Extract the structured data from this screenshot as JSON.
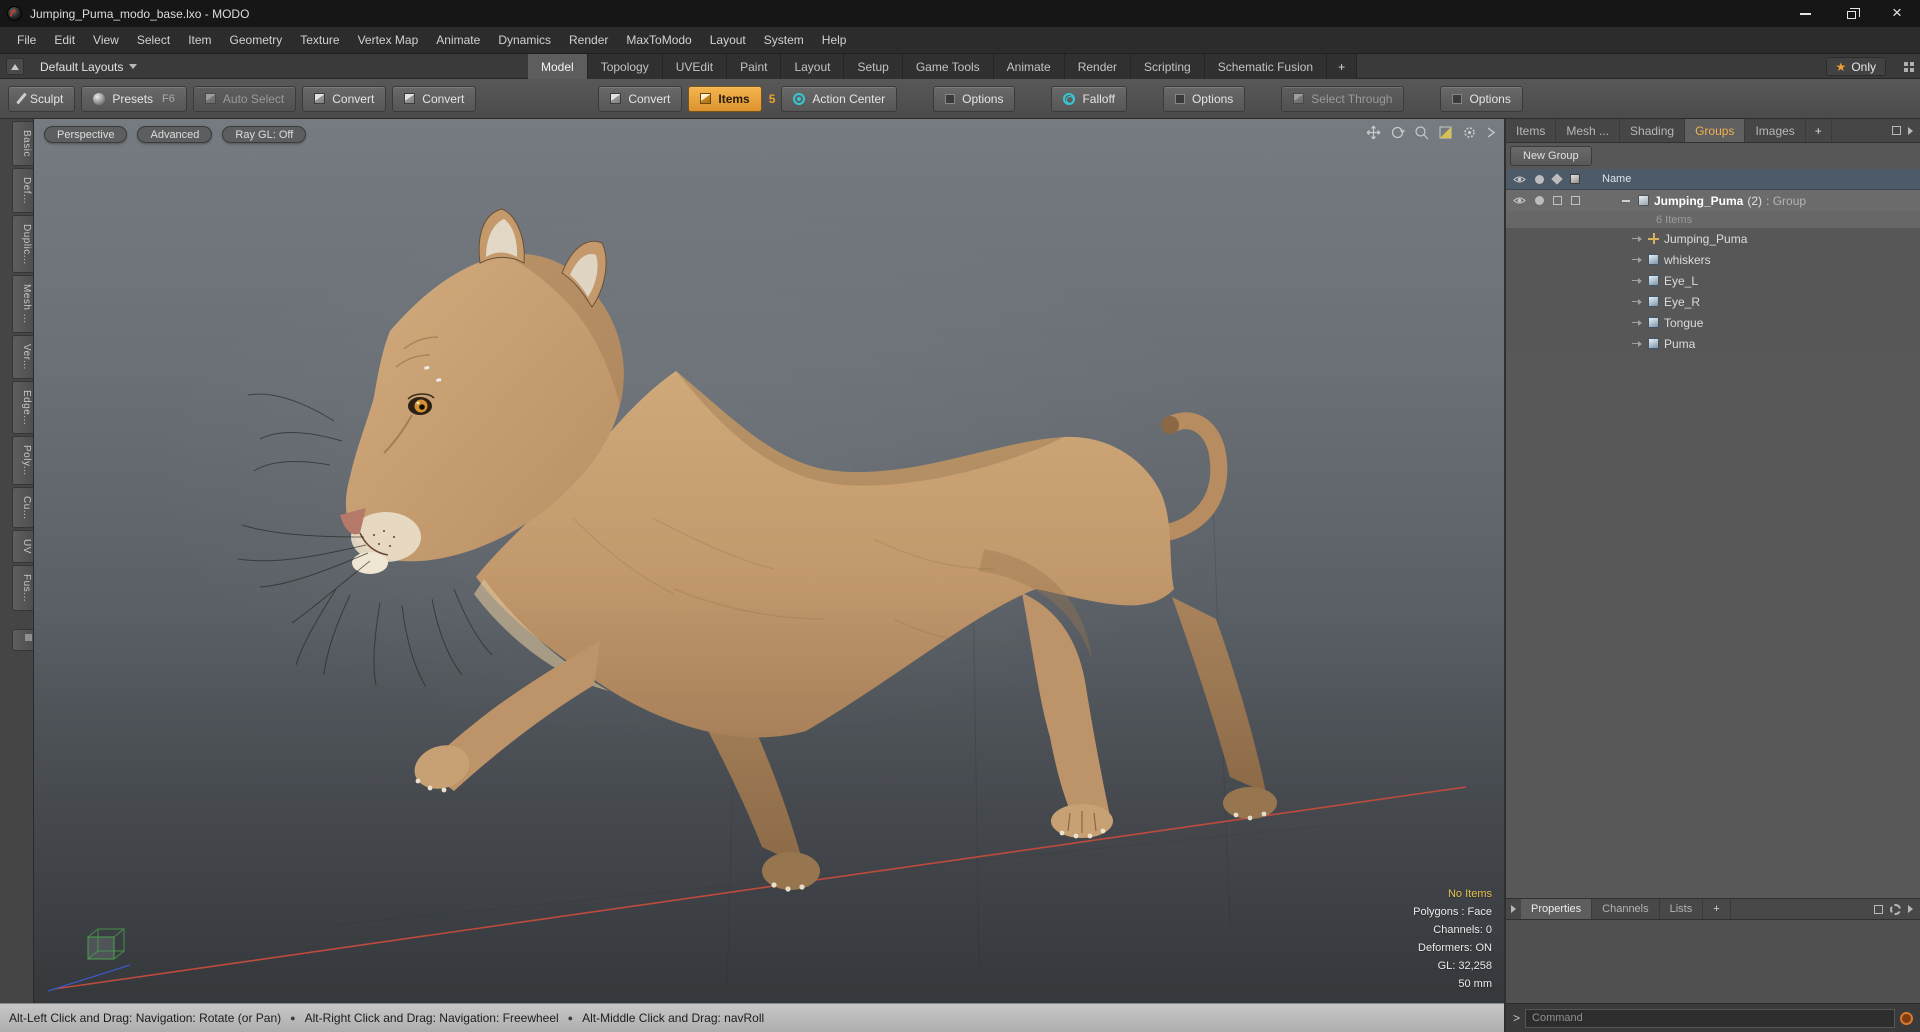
{
  "window": {
    "title": "Jumping_Puma_modo_base.lxo - MODO"
  },
  "menu": {
    "items": [
      "File",
      "Edit",
      "View",
      "Select",
      "Item",
      "Geometry",
      "Texture",
      "Vertex Map",
      "Animate",
      "Dynamics",
      "Render",
      "MaxToModo",
      "Layout",
      "System",
      "Help"
    ]
  },
  "layout_bar": {
    "switcher": "Default Layouts",
    "tabs": [
      "Model",
      "Topology",
      "UVEdit",
      "Paint",
      "Layout",
      "Setup",
      "Game Tools",
      "Animate",
      "Render",
      "Scripting",
      "Schematic Fusion"
    ],
    "add_tab": "+",
    "star": "★",
    "only": "Only"
  },
  "toolbar": {
    "sculpt": "Sculpt",
    "presets": "Presets",
    "presets_key": "F6",
    "auto_select": "Auto Select",
    "convert_a": "Convert",
    "convert_b": "Convert",
    "convert_c": "Convert",
    "items": "Items",
    "items_badge": "5",
    "action_center": "Action Center",
    "options_a": "Options",
    "falloff": "Falloff",
    "options_b": "Options",
    "select_through": "Select Through",
    "options_c": "Options"
  },
  "side_tabs": {
    "items": [
      "Basic",
      "Def...",
      "Duplic...",
      "Mesh ...",
      "Ver...",
      "Edge...",
      "Poly...",
      "Cu...",
      "UV",
      "Fus..."
    ]
  },
  "viewport": {
    "mode_button": "Perspective",
    "shading_button": "Advanced",
    "raygl_button": "Ray GL: Off",
    "stats": {
      "selection": "No Items",
      "mode": "Polygons : Face",
      "channels": "Channels: 0",
      "deformers": "Deformers: ON",
      "gl": "GL: 32,258",
      "scale": "50 mm"
    }
  },
  "right_panel": {
    "tabs": [
      "Items",
      "Mesh ...",
      "Shading",
      "Groups",
      "Images"
    ],
    "add_tab": "+",
    "new_group": "New Group",
    "tree": {
      "header": "Name",
      "group_name": "Jumping_Puma",
      "group_count": "(2)",
      "group_type": ": Group",
      "group_summary": "6 Items",
      "children": [
        "Jumping_Puma",
        "whiskers",
        "Eye_L",
        "Eye_R",
        "Tongue",
        "Puma"
      ]
    },
    "bottom_tabs": [
      "Properties",
      "Channels",
      "Lists"
    ],
    "bottom_add_tab": "+",
    "command": {
      "prompt": ">",
      "placeholder": "Command"
    }
  },
  "status_bar": {
    "hint1": "Alt-Left Click and Drag: Navigation: Rotate (or Pan)",
    "hint2": "Alt-Right Click and Drag: Navigation: Freewheel",
    "hint3": "Alt-Middle Click and Drag: navRoll",
    "bullet": "●"
  },
  "colors": {
    "accent_orange": "#e8a33c",
    "accent_teal": "#35c8d2",
    "stats_yellow": "#e3c04b",
    "axis_red": "#bf4a3d",
    "axis_blue": "#3b57c0"
  }
}
